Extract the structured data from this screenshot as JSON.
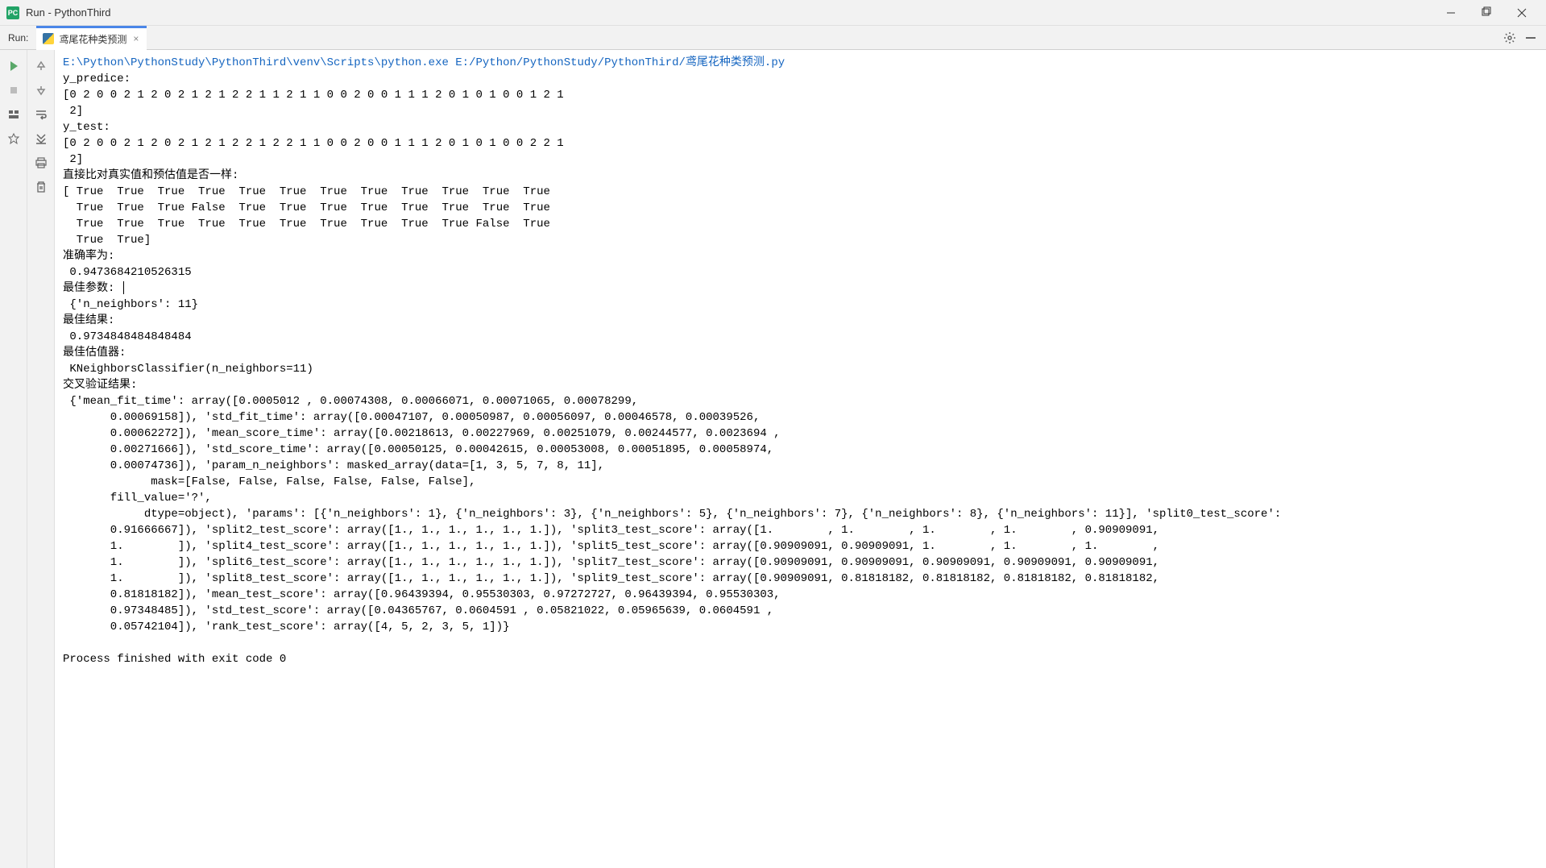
{
  "window": {
    "title": "Run - PythonThird"
  },
  "tabBar": {
    "runLabel": "Run:",
    "tabName": "鸢尾花种类预测"
  },
  "console": {
    "commandLine": "E:\\Python\\PythonStudy\\PythonThird\\venv\\Scripts\\python.exe E:/Python/PythonStudy/PythonThird/鸢尾花种类预测.py",
    "lines": [
      "y_predice:",
      "[0 2 0 0 2 1 2 0 2 1 2 1 2 2 1 1 2 1 1 0 0 2 0 0 1 1 1 2 0 1 0 1 0 0 1 2 1",
      " 2]",
      "y_test:",
      "[0 2 0 0 2 1 2 0 2 1 2 1 2 2 1 2 2 1 1 0 0 2 0 0 1 1 1 2 0 1 0 1 0 0 2 2 1",
      " 2]",
      "直接比对真实值和预估值是否一样:",
      "[ True  True  True  True  True  True  True  True  True  True  True  True",
      "  True  True  True False  True  True  True  True  True  True  True  True",
      "  True  True  True  True  True  True  True  True  True  True False  True",
      "  True  True]",
      "准确率为:",
      " 0.9473684210526315",
      "最佳参数:",
      " {'n_neighbors': 11}",
      "最佳结果:",
      " 0.9734848484848484",
      "最佳估值器:",
      " KNeighborsClassifier(n_neighbors=11)",
      "交叉验证结果:",
      " {'mean_fit_time': array([0.0005012 , 0.00074308, 0.00066071, 0.00071065, 0.00078299,",
      "       0.00069158]), 'std_fit_time': array([0.00047107, 0.00050987, 0.00056097, 0.00046578, 0.00039526,",
      "       0.00062272]), 'mean_score_time': array([0.00218613, 0.00227969, 0.00251079, 0.00244577, 0.0023694 ,",
      "       0.00271666]), 'std_score_time': array([0.00050125, 0.00042615, 0.00053008, 0.00051895, 0.00058974,",
      "       0.00074736]), 'param_n_neighbors': masked_array(data=[1, 3, 5, 7, 8, 11],",
      "             mask=[False, False, False, False, False, False],",
      "       fill_value='?',",
      "            dtype=object), 'params': [{'n_neighbors': 1}, {'n_neighbors': 3}, {'n_neighbors': 5}, {'n_neighbors': 7}, {'n_neighbors': 8}, {'n_neighbors': 11}], 'split0_test_score':",
      "       0.91666667]), 'split2_test_score': array([1., 1., 1., 1., 1., 1.]), 'split3_test_score': array([1.        , 1.        , 1.        , 1.        , 0.90909091,",
      "       1.        ]), 'split4_test_score': array([1., 1., 1., 1., 1., 1.]), 'split5_test_score': array([0.90909091, 0.90909091, 1.        , 1.        , 1.        ,",
      "       1.        ]), 'split6_test_score': array([1., 1., 1., 1., 1., 1.]), 'split7_test_score': array([0.90909091, 0.90909091, 0.90909091, 0.90909091, 0.90909091,",
      "       1.        ]), 'split8_test_score': array([1., 1., 1., 1., 1., 1.]), 'split9_test_score': array([0.90909091, 0.81818182, 0.81818182, 0.81818182, 0.81818182,",
      "       0.81818182]), 'mean_test_score': array([0.96439394, 0.95530303, 0.97272727, 0.96439394, 0.95530303,",
      "       0.97348485]), 'std_test_score': array([0.04365767, 0.0604591 , 0.05821022, 0.05965639, 0.0604591 ,",
      "       0.05742104]), 'rank_test_score': array([4, 5, 2, 3, 5, 1])}"
    ],
    "exitLine": "Process finished with exit code 0"
  }
}
